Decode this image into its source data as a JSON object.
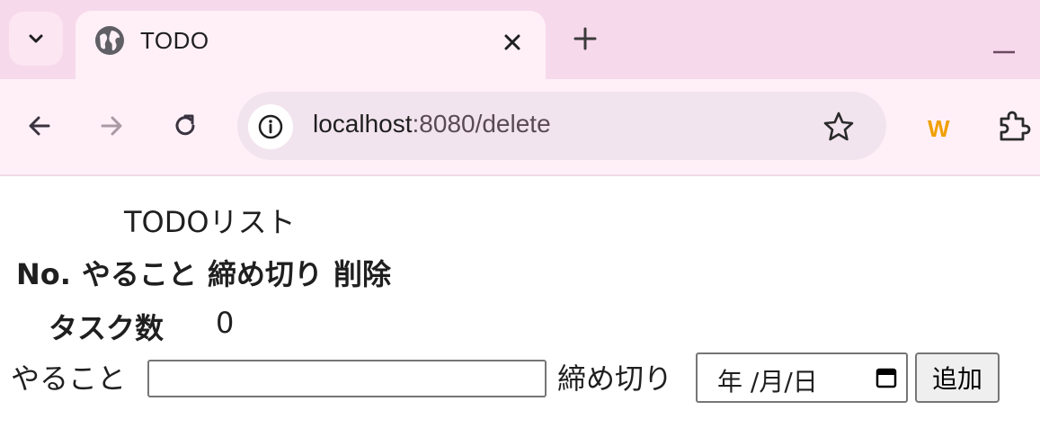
{
  "browser": {
    "tab_title": "TODO",
    "url_host": "localhost",
    "url_path": ":8080/delete",
    "extension_label": "W",
    "icons": {
      "tab_menu": "chevron-down-icon",
      "favicon": "globe-icon",
      "close": "close-icon",
      "new_tab": "plus-icon",
      "minimize": "minimize-icon",
      "back": "arrow-left-icon",
      "forward": "arrow-right-icon",
      "reload": "reload-icon",
      "site_info": "info-icon",
      "bookmark": "star-icon",
      "extensions": "puzzle-icon"
    }
  },
  "page": {
    "title": "TODOリスト",
    "table_headers": [
      "No.",
      "やること",
      "締め切り",
      "削除"
    ],
    "task_count_label": "タスク数",
    "task_count_value": "0",
    "form": {
      "todo_label": "やること",
      "todo_value": "",
      "deadline_label": "締め切り",
      "date_placeholder": "年 /月/日",
      "add_button": "追加"
    }
  }
}
